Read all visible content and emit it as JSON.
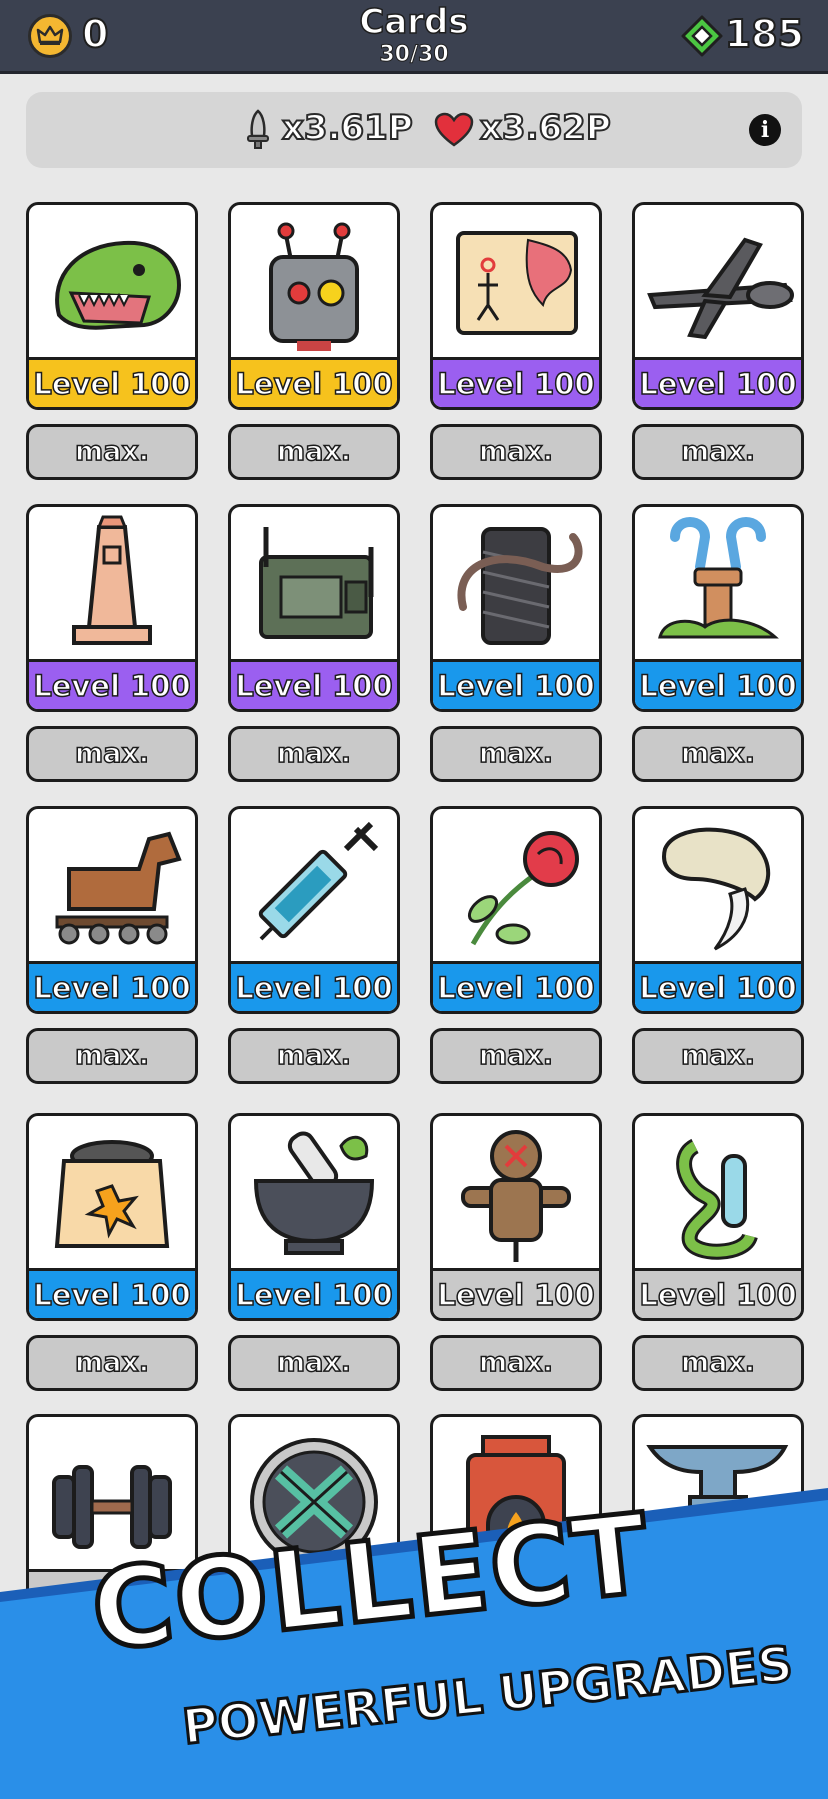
{
  "header": {
    "title": "Cards",
    "count": "30/30",
    "crowns": "0",
    "gems": "185"
  },
  "multipliers": {
    "attack": "x3.61P",
    "health": "x3.62P"
  },
  "colors": {
    "gold": "#f6c21d",
    "purple": "#9b5ff0",
    "blue": "#1998ec",
    "gray": "#c9c9c9",
    "banner": "#2a8fe8"
  },
  "cards": [
    {
      "icon": "dinosaur-head-icon",
      "level": "Level 100",
      "rarity": "gold",
      "button": "max."
    },
    {
      "icon": "robot-icon",
      "level": "Level 100",
      "rarity": "gold",
      "button": "max."
    },
    {
      "icon": "treasure-map-icon",
      "level": "Level 100",
      "rarity": "purple",
      "button": "max."
    },
    {
      "icon": "drone-icon",
      "level": "Level 100",
      "rarity": "purple",
      "button": "max."
    },
    {
      "icon": "obelisk-icon",
      "level": "Level 100",
      "rarity": "purple",
      "button": "max."
    },
    {
      "icon": "radio-icon",
      "level": "Level 100",
      "rarity": "purple",
      "button": "max."
    },
    {
      "icon": "thread-spool-icon",
      "level": "Level 100",
      "rarity": "blue",
      "button": "max."
    },
    {
      "icon": "fountain-icon",
      "level": "Level 100",
      "rarity": "blue",
      "button": "max."
    },
    {
      "icon": "trojan-horse-icon",
      "level": "Level 100",
      "rarity": "blue",
      "button": "max."
    },
    {
      "icon": "syringe-icon",
      "level": "Level 100",
      "rarity": "blue",
      "button": "max."
    },
    {
      "icon": "rose-icon",
      "level": "Level 100",
      "rarity": "blue",
      "button": "max."
    },
    {
      "icon": "fang-icon",
      "level": "Level 100",
      "rarity": "blue",
      "button": "max."
    },
    {
      "icon": "gunpowder-sack-icon",
      "level": "Level 100",
      "rarity": "blue",
      "button": "max."
    },
    {
      "icon": "mortar-pestle-icon",
      "level": "Level 100",
      "rarity": "blue",
      "button": "max."
    },
    {
      "icon": "voodoo-doll-icon",
      "level": "Level 100",
      "rarity": "gray",
      "button": "max."
    },
    {
      "icon": "snake-potion-icon",
      "level": "Level 100",
      "rarity": "gray",
      "button": "max."
    },
    {
      "icon": "dumbbell-icon",
      "level": "",
      "rarity": "gray",
      "button": ""
    },
    {
      "icon": "celtic-knot-icon",
      "level": "",
      "rarity": "gray",
      "button": ""
    },
    {
      "icon": "furnace-icon",
      "level": "",
      "rarity": "gray",
      "button": ""
    },
    {
      "icon": "anvil-icon",
      "level": "",
      "rarity": "gray",
      "button": ""
    }
  ],
  "banner": {
    "headline": "COLLECT",
    "subline": "POWERFUL UPGRADES"
  }
}
